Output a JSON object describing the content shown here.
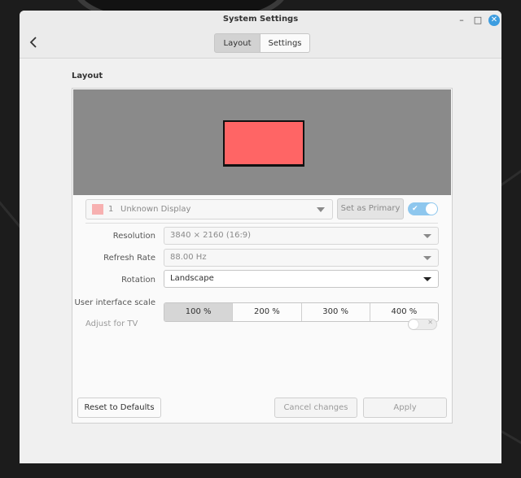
{
  "window": {
    "title": "System Settings"
  },
  "titlebar_buttons": {
    "minimize": "–",
    "maximize": "□",
    "close": "✕"
  },
  "tabs": [
    {
      "label": "Layout",
      "selected": true
    },
    {
      "label": "Settings",
      "selected": false
    }
  ],
  "section": {
    "title": "Layout"
  },
  "display": {
    "number": "1",
    "name": "Unknown Display",
    "swatch_color": "#f7b0b0",
    "monitor_color": "#ff6565"
  },
  "primary_button": "Set as Primary",
  "display_enabled": true,
  "toggle_check": "✔",
  "rows": {
    "resolution": {
      "label": "Resolution",
      "value": "3840 × 2160 (16:9)"
    },
    "refresh_rate": {
      "label": "Refresh Rate",
      "value": "88.00 Hz"
    },
    "rotation": {
      "label": "Rotation",
      "value": "Landscape"
    },
    "scale": {
      "label": "User interface scale",
      "options": [
        "100 %",
        "200 %",
        "300 %",
        "400 %"
      ],
      "selected": "100 %"
    },
    "adjust_tv": {
      "label": "Adjust for TV",
      "enabled": false,
      "off_glyph": "✕"
    }
  },
  "footer": {
    "reset": "Reset to Defaults",
    "cancel": "Cancel changes",
    "apply": "Apply"
  }
}
